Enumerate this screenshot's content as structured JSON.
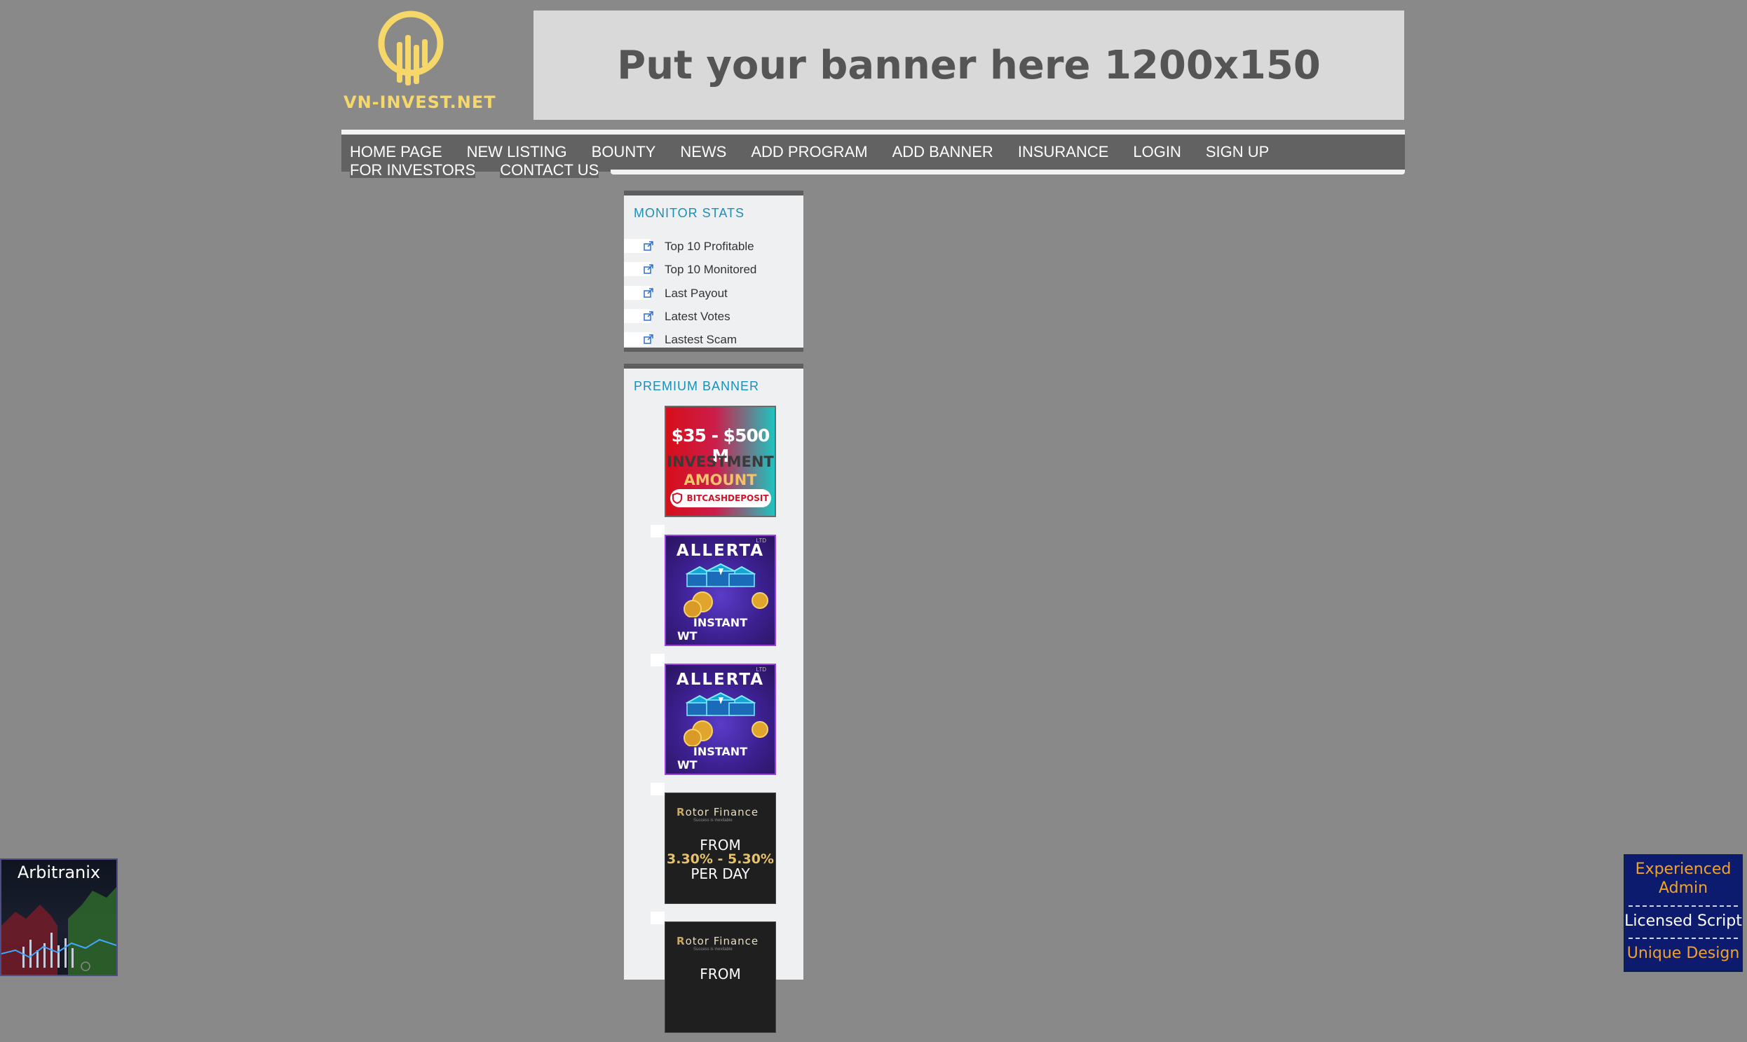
{
  "logo": {
    "text": "VN-INVEST.NET",
    "color": "#f5d76a"
  },
  "top_banner": {
    "text": "Put your banner here 1200x150"
  },
  "nav": {
    "row1": [
      "HOME PAGE",
      "NEW LISTING",
      "BOUNTY",
      "NEWS",
      "ADD PROGRAM",
      "ADD BANNER",
      "INSURANCE",
      "LOGIN",
      "SIGN UP"
    ],
    "row2": [
      "FOR INVESTORS",
      "CONTACT US"
    ]
  },
  "monitor_stats": {
    "title": "MONITOR STATS",
    "items": [
      "Top 10 Profitable",
      "Top 10 Monitored",
      "Last Payout",
      "Latest Votes",
      "Lastest Scam"
    ]
  },
  "premium_banner": {
    "title": "PREMIUM BANNER",
    "ads": [
      {
        "type": "bitcash",
        "line1": "$35 - $500 M",
        "line2": "INVESTMENT",
        "line3": "AMOUNT",
        "brand": "BITCASHDEPOSIT"
      },
      {
        "type": "allerta",
        "title": "ALLERTA",
        "tag": "INSTANT",
        "corner": "WT",
        "badge": "LTD"
      },
      {
        "type": "allerta",
        "title": "ALLERTA",
        "tag": "INSTANT",
        "corner": "WT",
        "badge": "LTD"
      },
      {
        "type": "rotor",
        "brand_initial": "R",
        "brand_rest": "otor Finance",
        "sub": "Success is inevitable",
        "line1": "FROM",
        "line2": "3.30% - 5.30%",
        "line3": "PER DAY"
      },
      {
        "type": "rotor",
        "brand_initial": "R",
        "brand_rest": "otor Finance",
        "sub": "Success is inevitable",
        "line1": "FROM"
      }
    ]
  },
  "float_left": {
    "title": "Arbitranix"
  },
  "float_right": {
    "line1": "Experienced",
    "line2": "Admin",
    "line3": "Licensed Script",
    "line4": "Unique Design"
  }
}
